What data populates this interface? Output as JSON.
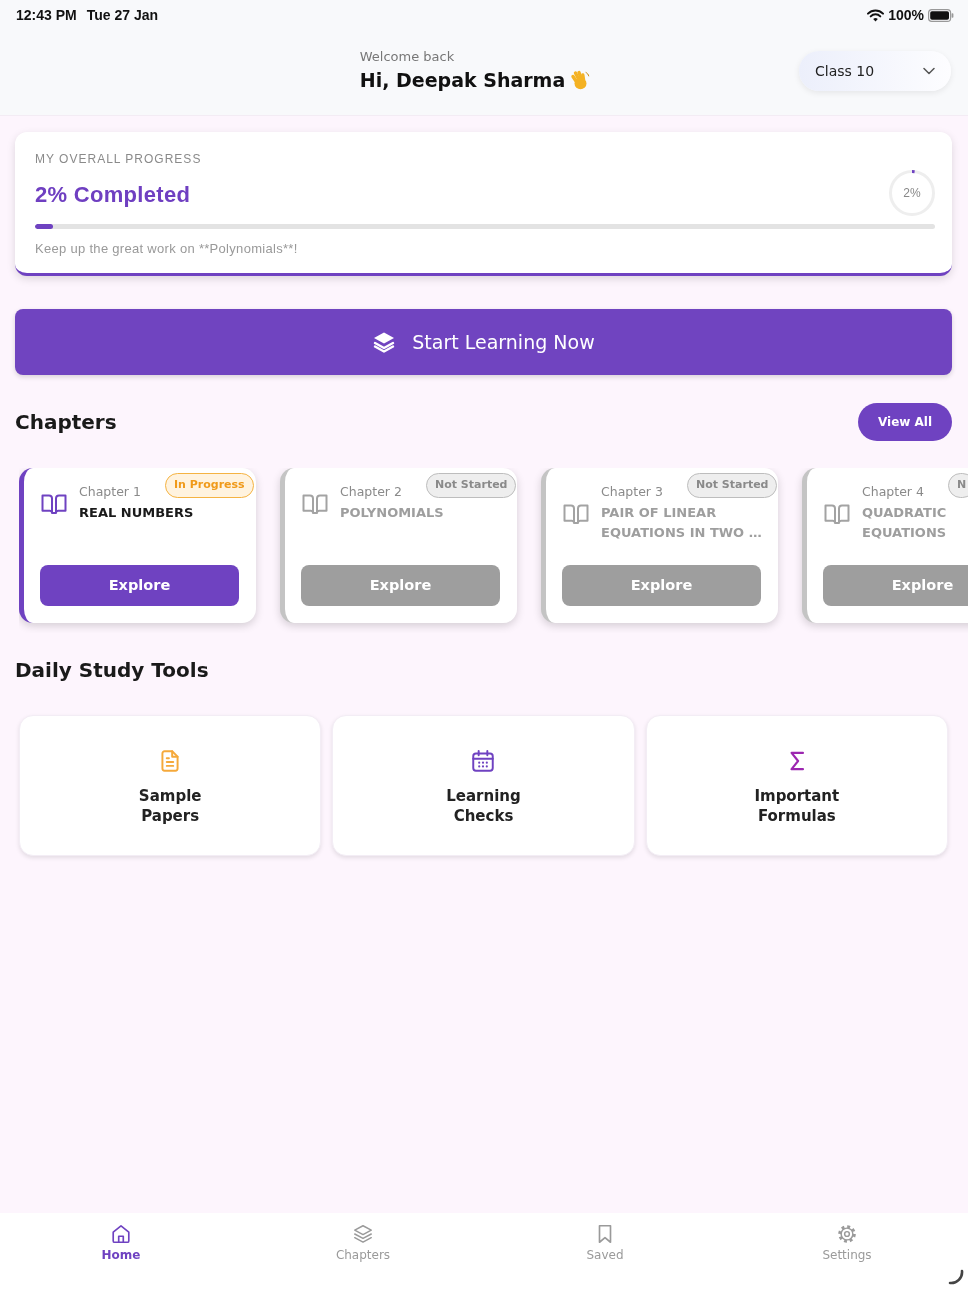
{
  "status_bar": {
    "time": "12:43 PM",
    "date": "Tue 27 Jan",
    "battery": "100%"
  },
  "header": {
    "subtitle": "Welcome back",
    "greeting": "Hi, Deepak Sharma",
    "class_select": {
      "value": "Class 10"
    }
  },
  "progress": {
    "label": "MY OVERALL PROGRESS",
    "title": "2% Completed",
    "ring_label": "2%",
    "level": 0.02,
    "note": "Keep up the great work on **Polynomials**!"
  },
  "start_button": {
    "label": "Start Learning Now"
  },
  "chapters": {
    "title": "Chapters",
    "view_all": "View All",
    "items": [
      {
        "number": "Chapter 1",
        "title": "REAL NUMBERS",
        "badge": "In Progress",
        "kind": "in_progress",
        "button": "Explore"
      },
      {
        "number": "Chapter 2",
        "title": "POLYNOMIALS",
        "badge": "Not Started",
        "kind": "not_started",
        "button": "Explore"
      },
      {
        "number": "Chapter 3",
        "title": "PAIR OF LINEAR EQUATIONS IN TWO …",
        "badge": "Not Started",
        "kind": "not_started",
        "button": "Explore"
      },
      {
        "number": "Chapter 4",
        "title": "QUADRATIC EQUATIONS",
        "badge": "N",
        "kind": "not_started",
        "button": "Explore"
      }
    ]
  },
  "tools": {
    "title": "Daily Study Tools",
    "items": [
      {
        "label": "Sample Papers",
        "color": "#f5a93b"
      },
      {
        "label": "Learning Checks",
        "color": "#6f42c1"
      },
      {
        "label": "Important Formulas",
        "color": "#9c27b0"
      }
    ]
  },
  "bottom_nav": [
    {
      "label": "Home",
      "selected": true
    },
    {
      "label": "Chapters",
      "selected": false
    },
    {
      "label": "Saved",
      "selected": false
    },
    {
      "label": "Settings",
      "selected": false
    }
  ]
}
